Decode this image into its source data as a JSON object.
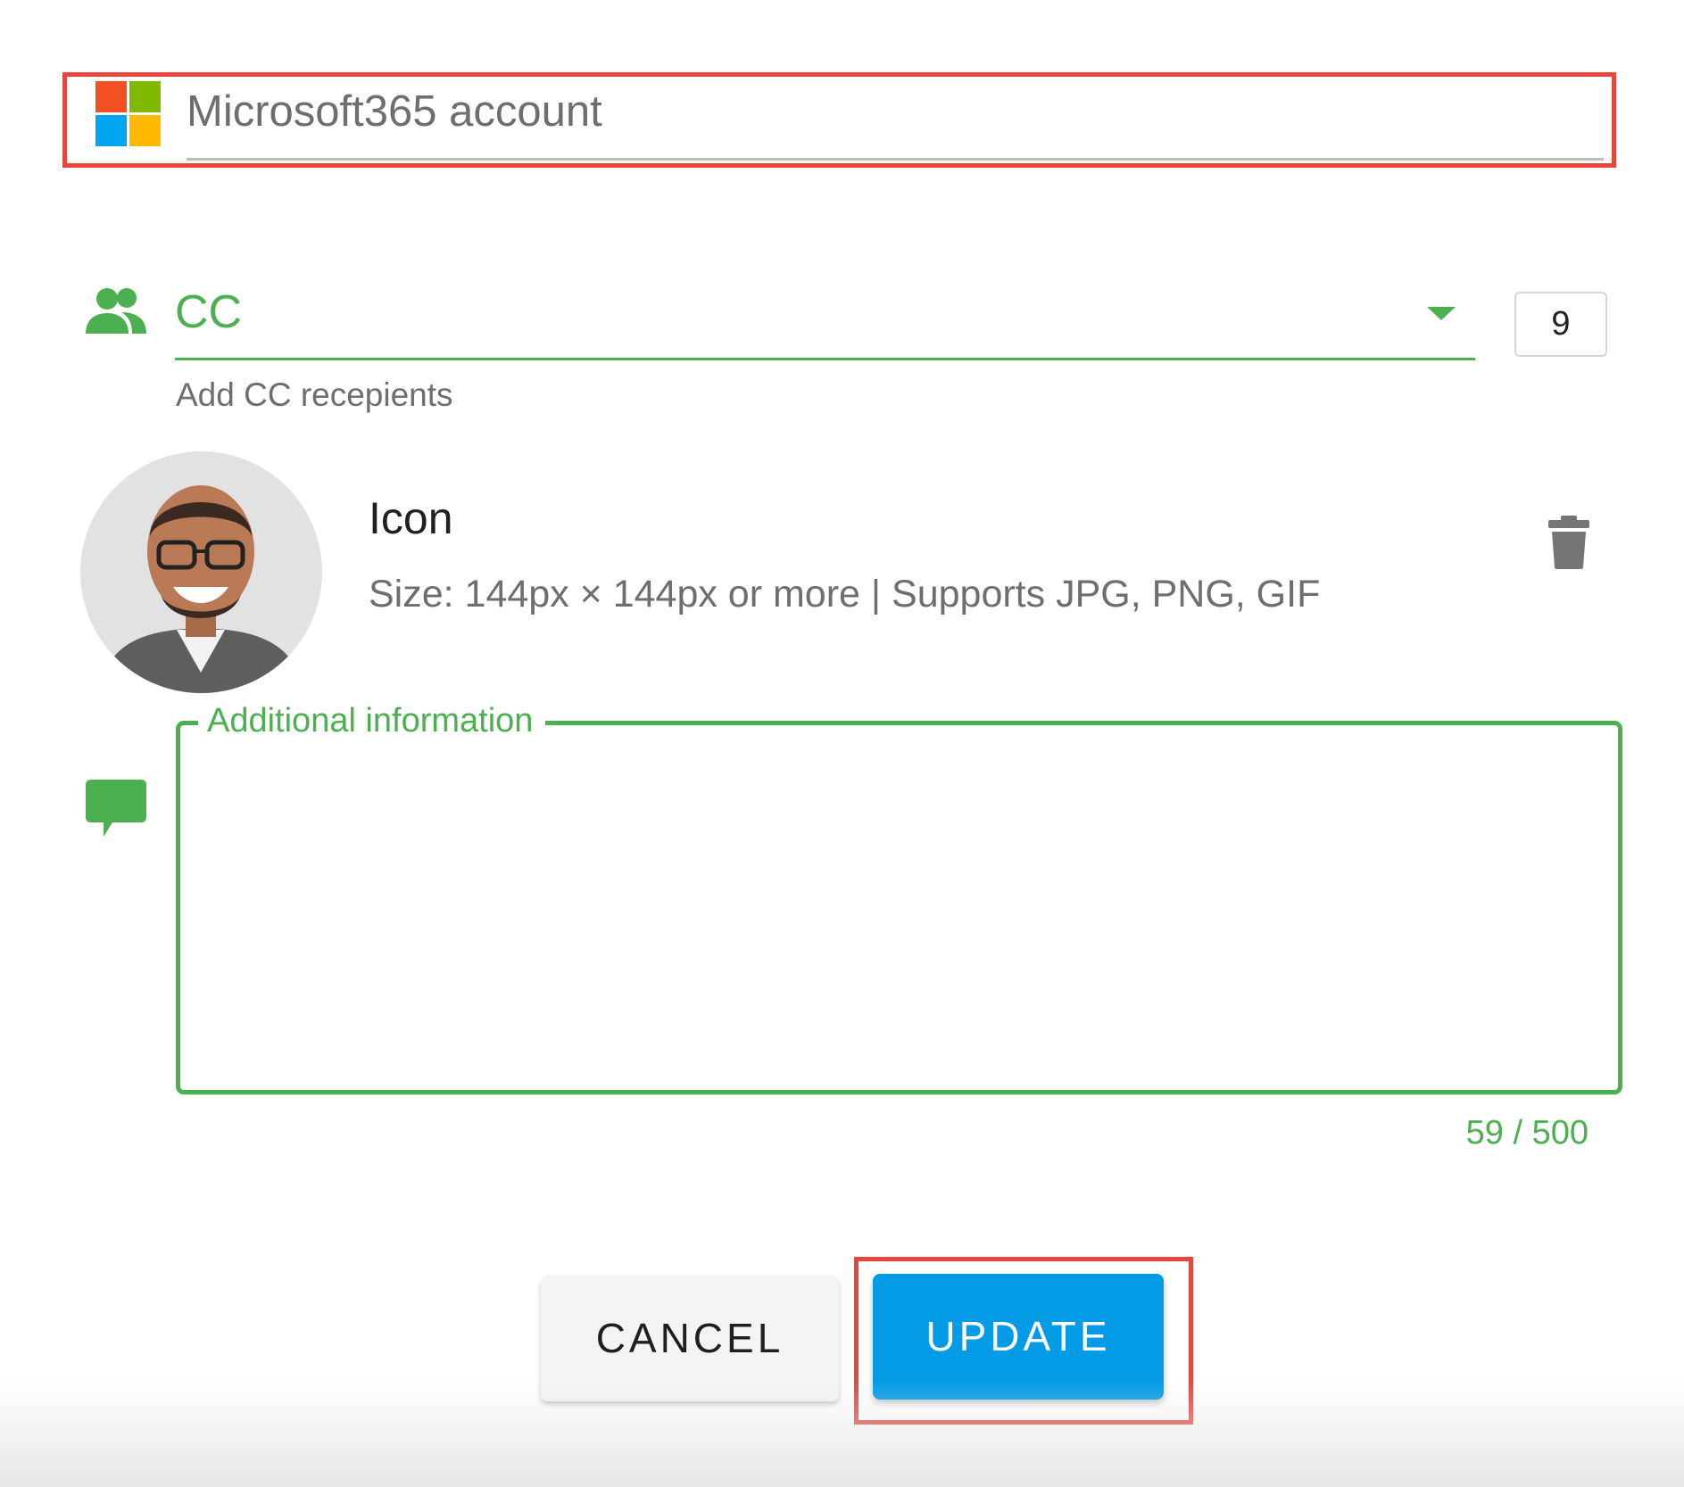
{
  "account": {
    "label": "Microsoft365 account",
    "logo_colors": [
      "#f25022",
      "#7fba00",
      "#00a4ef",
      "#ffb900"
    ]
  },
  "cc": {
    "label": "CC",
    "helper": "Add CC recepients",
    "count": "9"
  },
  "icon_section": {
    "title": "Icon",
    "description": "Size: 144px × 144px or more | Supports JPG, PNG, GIF"
  },
  "additional_info": {
    "label": "Additional information",
    "value": "",
    "counter": "59 / 500"
  },
  "buttons": {
    "cancel": "CANCEL",
    "update": "UPDATE"
  },
  "colors": {
    "accent_green": "#4caf50",
    "primary_blue": "#039be5",
    "highlight_red": "#e8453c"
  },
  "icons": [
    "microsoft-logo",
    "people-icon",
    "trash-icon",
    "chat-icon",
    "chevron-down-icon"
  ]
}
